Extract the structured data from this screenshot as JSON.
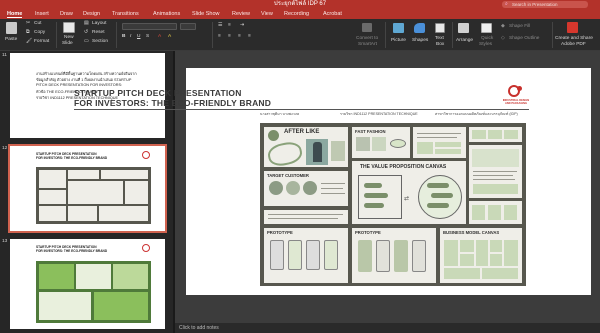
{
  "window": {
    "title": "ประยุกต์ไฟล์ IDP 67",
    "search_placeholder": "Search in Presentation"
  },
  "tabs": [
    "Home",
    "Insert",
    "Draw",
    "Design",
    "Transitions",
    "Animations",
    "Slide Show",
    "Review",
    "View",
    "Recording",
    "Acrobat"
  ],
  "ribbon": {
    "paste": "Paste",
    "cut": "Cut",
    "copy": "Copy",
    "format": "Format",
    "new_slide_1": "New",
    "new_slide_2": "Slide",
    "layout": "Layout",
    "reset": "Reset",
    "section": "Section",
    "convert_1": "Convert to",
    "convert_2": "SmartArt",
    "picture": "Picture",
    "shapes": "Shapes",
    "textbox_1": "Text",
    "textbox_2": "Box",
    "arrange": "Arrange",
    "quick_styles_1": "Quick",
    "quick_styles_2": "Styles",
    "shape_fill": "Shape Fill",
    "shape_outline": "Shape Outline",
    "adobe_1": "Create and Share",
    "adobe_2": "Adobe PDF"
  },
  "thumbnails": {
    "slide11": {
      "number": "11",
      "lines": [
        "งานสร้างแบรนด์ที่มีพื้นฐานความโดดเด่น สร้างความยั่งยืนจาก",
        "ข้อมูลสำคัญ ตัวอย่าง งานที่ 1 ถึงผลงานนำเสนอ STARTUP",
        "PITCH DECK PRESENTATION FOR INVESTORS:",
        "หัวข้อ THE ECO-FRIENDLY BRAND",
        "รายวิชา IND1112 PRESENTATION TECHNIQUE"
      ]
    },
    "slide12": {
      "number": "12",
      "title_1": "STARTUP PITCH DECK PRESENTATION",
      "title_2": "FOR INVESTORS: THE ECO-FRIENDLY BRAND"
    },
    "slide13": {
      "number": "13",
      "title_1": "STARTUP PITCH DECK PRESENTATION",
      "title_2": "FOR INVESTORS: THE ECO-FRIENDLY BRAND"
    }
  },
  "slide": {
    "title_1": "STARTUP PITCH DECK PRESENTATION",
    "title_2": "FOR INVESTORS: THE ECO-FRIENDLY BRAND",
    "author": "นางสาวชุติมา บางพงวงษ",
    "course": "รายวิชา IND1112 PRESENTATION TECHNIQUE",
    "program": "สาขาวิชาการออกแบบผลิตภัณฑ์และบรรจุภัณฑ์ (IDP)",
    "logo_text": "INDUSTRIAL DESIGN AND PACKAGING",
    "panels": {
      "after_like": "AFTER LIKE",
      "fast_fashion": "FAST FASHION",
      "target": "TARGET CUSTOMER",
      "value_prop": "THE VALUE PROPOSITION CANVAS",
      "prototype_1": "PROTOTYPE",
      "prototype_2": "PROTOTYPE",
      "business": "BUSINESS MODEL CANVAS"
    }
  },
  "notes": {
    "placeholder": "Click to add notes"
  },
  "colors": {
    "brand": "#b3322a",
    "accent_red": "#d0624f",
    "poster_bg": "#57574e",
    "green": "#7b8f6a"
  }
}
